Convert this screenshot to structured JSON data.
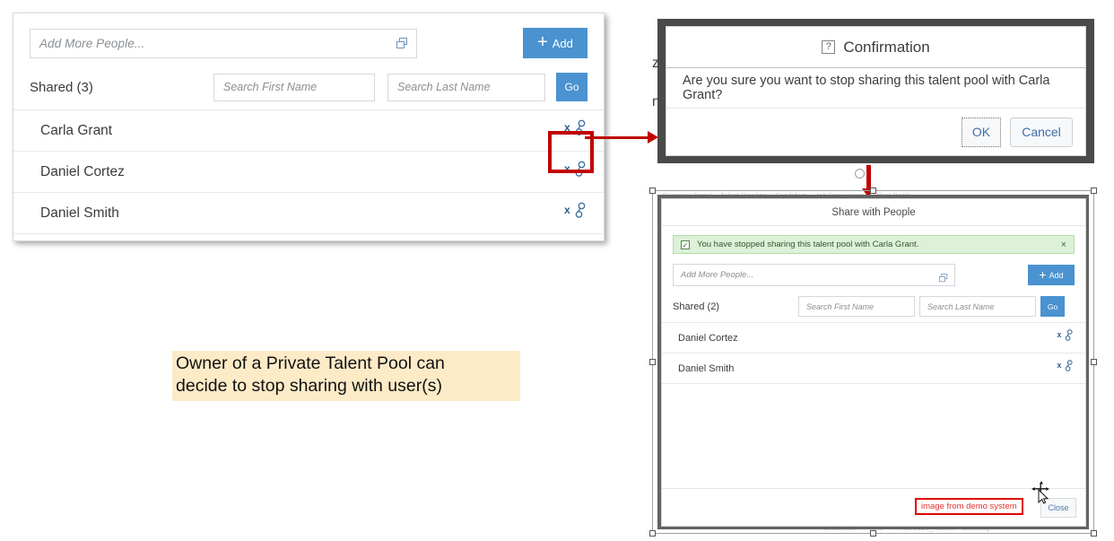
{
  "main_panel": {
    "name": "Share with People panel",
    "add_input": {
      "placeholder": "Add More People...",
      "value": "",
      "icon": "copy-icon"
    },
    "add_button": {
      "label": "Add",
      "icon": "plus-icon",
      "color": "#4a92d0"
    },
    "shared_label": "Shared (3)",
    "search_first": {
      "placeholder": "Search First Name",
      "value": ""
    },
    "search_last": {
      "placeholder": "Search Last Name",
      "value": ""
    },
    "go_button": {
      "label": "Go",
      "color": "#4a92d0"
    },
    "people": [
      {
        "name": "Carla Grant",
        "action_icon": "unshare-icon",
        "highlighted": true
      },
      {
        "name": "Daniel Cortez",
        "action_icon": "unshare-icon",
        "highlighted": false
      },
      {
        "name": "Daniel Smith",
        "action_icon": "unshare-icon",
        "highlighted": false
      }
    ]
  },
  "annotation": {
    "line1": "Owner of a Private Talent Pool can",
    "line2": "decide to stop sharing with user(s)",
    "background_color": "#fdebc8"
  },
  "confirmation_dialog": {
    "title": "Confirmation",
    "title_icon": "question-mark-icon",
    "message": "Are you sure you want to stop sharing this talent pool with Carla Grant?",
    "ok_button": "OK",
    "cancel_button": "Cancel",
    "frame_color": "#4a4a4a"
  },
  "background_letters": {
    "top": "z",
    "bottom": "n"
  },
  "share_dialog": {
    "title": "Share with People",
    "alert": {
      "icon": "checkbox-checked-icon",
      "message": "You have stopped sharing this talent pool with Carla Grant.",
      "close_icon": "close-icon",
      "background_color": "#ddf0d8"
    },
    "add_input": {
      "placeholder": "Add More People...",
      "value": "",
      "icon": "copy-icon"
    },
    "add_button": {
      "label": "Add",
      "icon": "plus-icon",
      "color": "#4a92d0"
    },
    "shared_label": "Shared (2)",
    "search_first": {
      "placeholder": "Search First Name",
      "value": ""
    },
    "search_last": {
      "placeholder": "Search Last Name",
      "value": ""
    },
    "go_button": {
      "label": "Go",
      "color": "#4a92d0"
    },
    "people": [
      {
        "name": "Daniel Cortez",
        "action_icon": "unshare-icon"
      },
      {
        "name": "Daniel Smith",
        "action_icon": "unshare-icon"
      }
    ],
    "demo_tag": "image from demo system",
    "demo_tag_color": "#e33030",
    "close_button": "Close"
  },
  "arrows": {
    "color": "#c00000"
  }
}
